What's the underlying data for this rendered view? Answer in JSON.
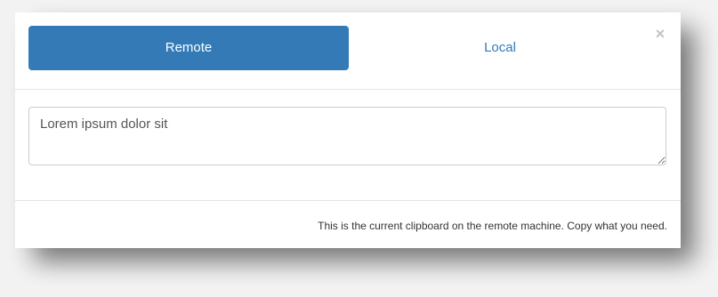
{
  "tabs": {
    "remote_label": "Remote",
    "local_label": "Local",
    "active": "Remote"
  },
  "dialog": {
    "close_glyph": "×",
    "close_icon": "close-icon"
  },
  "clipboard": {
    "value": "Lorem ipsum dolor sit"
  },
  "footer": {
    "hint": "This is the current clipboard on the remote machine. Copy what you need."
  },
  "colors": {
    "accent": "#337ab7",
    "close": "#c4c4c4",
    "border": "#cccccc"
  }
}
